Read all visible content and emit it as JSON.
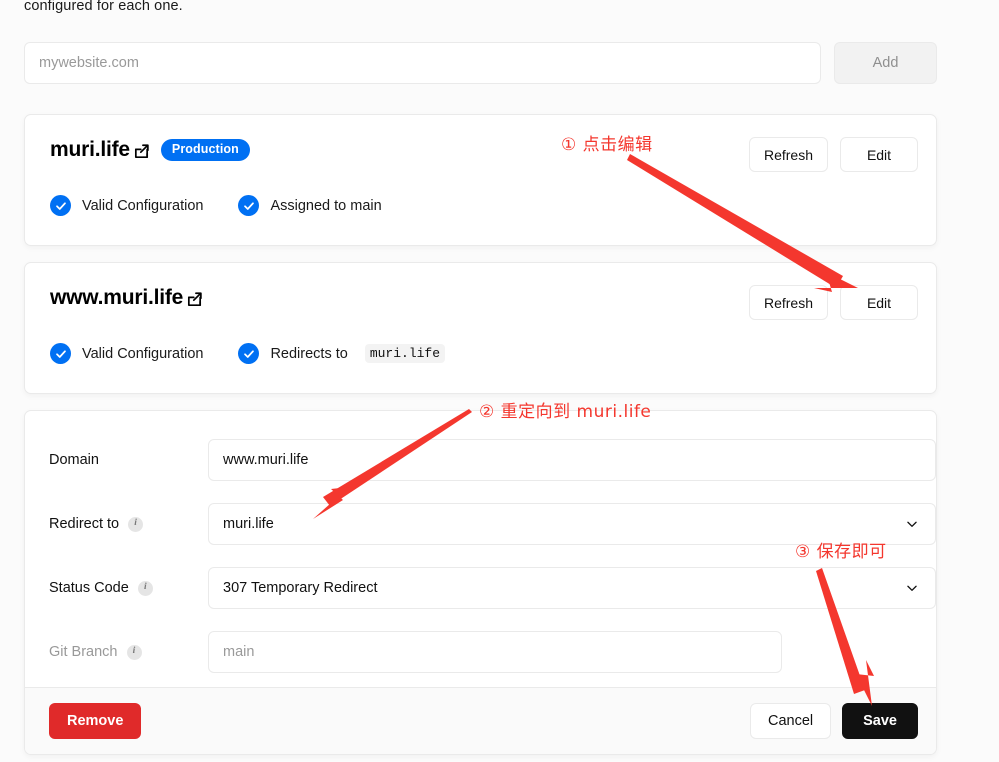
{
  "intro": {
    "text": "configured for each one."
  },
  "add_domain": {
    "input_placeholder": "mywebsite.com",
    "input_value": "",
    "add_label": "Add"
  },
  "domains": [
    {
      "name": "muri.life",
      "badge": "Production",
      "statuses": [
        "Valid Configuration",
        "Assigned to main"
      ],
      "refresh_label": "Refresh",
      "edit_label": "Edit"
    },
    {
      "name": "www.muri.life",
      "badge": "",
      "statuses": [
        "Valid Configuration",
        "Redirects to"
      ],
      "redirect_target": "muri.life",
      "refresh_label": "Refresh",
      "edit_label": "Edit"
    }
  ],
  "edit_form": {
    "rows": {
      "domain": {
        "label": "Domain",
        "value": "www.muri.life"
      },
      "redirect_to": {
        "label": "Redirect to",
        "value": "muri.life"
      },
      "status_code": {
        "label": "Status Code",
        "value": "307 Temporary Redirect"
      },
      "git_branch": {
        "label": "Git Branch",
        "placeholder": "main"
      }
    },
    "footer": {
      "remove_label": "Remove",
      "cancel_label": "Cancel",
      "save_label": "Save"
    }
  },
  "annotations": [
    {
      "id": 1,
      "text": "① 点击编辑"
    },
    {
      "id": 2,
      "text": "② 重定向到 muri.life"
    },
    {
      "id": 3,
      "text": "③ 保存即可"
    }
  ],
  "colors": {
    "accent_blue": "#0070f3",
    "danger_red": "#e02a2a",
    "annotation_red": "#f4372e",
    "save_black": "#111111"
  }
}
